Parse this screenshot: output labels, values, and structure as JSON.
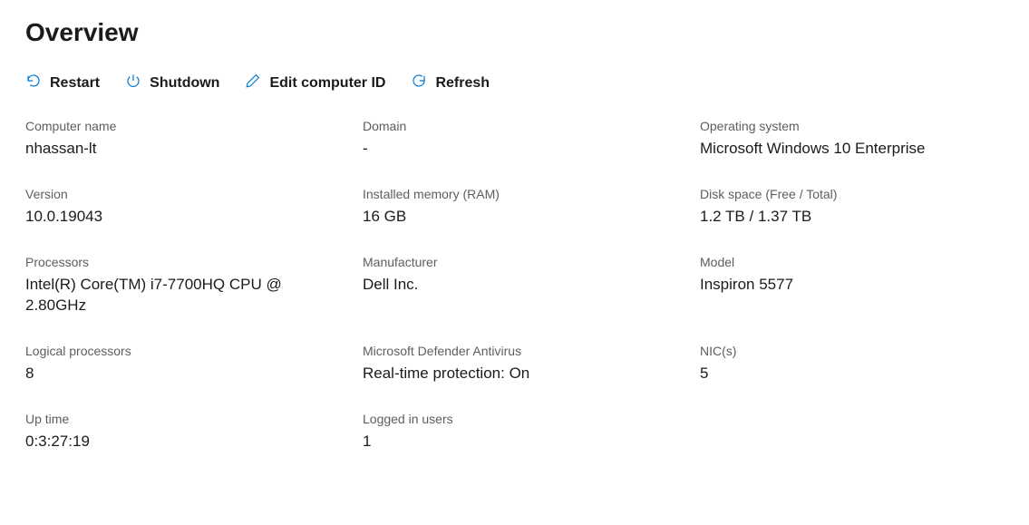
{
  "page": {
    "title": "Overview"
  },
  "toolbar": {
    "restart_label": "Restart",
    "shutdown_label": "Shutdown",
    "edit_id_label": "Edit computer ID",
    "refresh_label": "Refresh"
  },
  "fields": {
    "computer_name": {
      "label": "Computer name",
      "value": "nhassan-lt"
    },
    "domain": {
      "label": "Domain",
      "value": "-"
    },
    "operating_system": {
      "label": "Operating system",
      "value": "Microsoft Windows 10 Enterprise"
    },
    "version": {
      "label": "Version",
      "value": "10.0.19043"
    },
    "installed_memory": {
      "label": "Installed memory (RAM)",
      "value": "16 GB"
    },
    "disk_space": {
      "label": "Disk space (Free / Total)",
      "value": "1.2 TB / 1.37 TB"
    },
    "processors": {
      "label": "Processors",
      "value": "Intel(R) Core(TM) i7-7700HQ CPU @ 2.80GHz"
    },
    "manufacturer": {
      "label": "Manufacturer",
      "value": "Dell Inc."
    },
    "model": {
      "label": "Model",
      "value": "Inspiron 5577"
    },
    "logical_processors": {
      "label": "Logical processors",
      "value": "8"
    },
    "defender": {
      "label": "Microsoft Defender Antivirus",
      "value": "Real-time protection: On"
    },
    "nics": {
      "label": "NIC(s)",
      "value": "5"
    },
    "uptime": {
      "label": "Up time",
      "value": "0:3:27:19"
    },
    "logged_in": {
      "label": "Logged in users",
      "value": "1"
    }
  }
}
